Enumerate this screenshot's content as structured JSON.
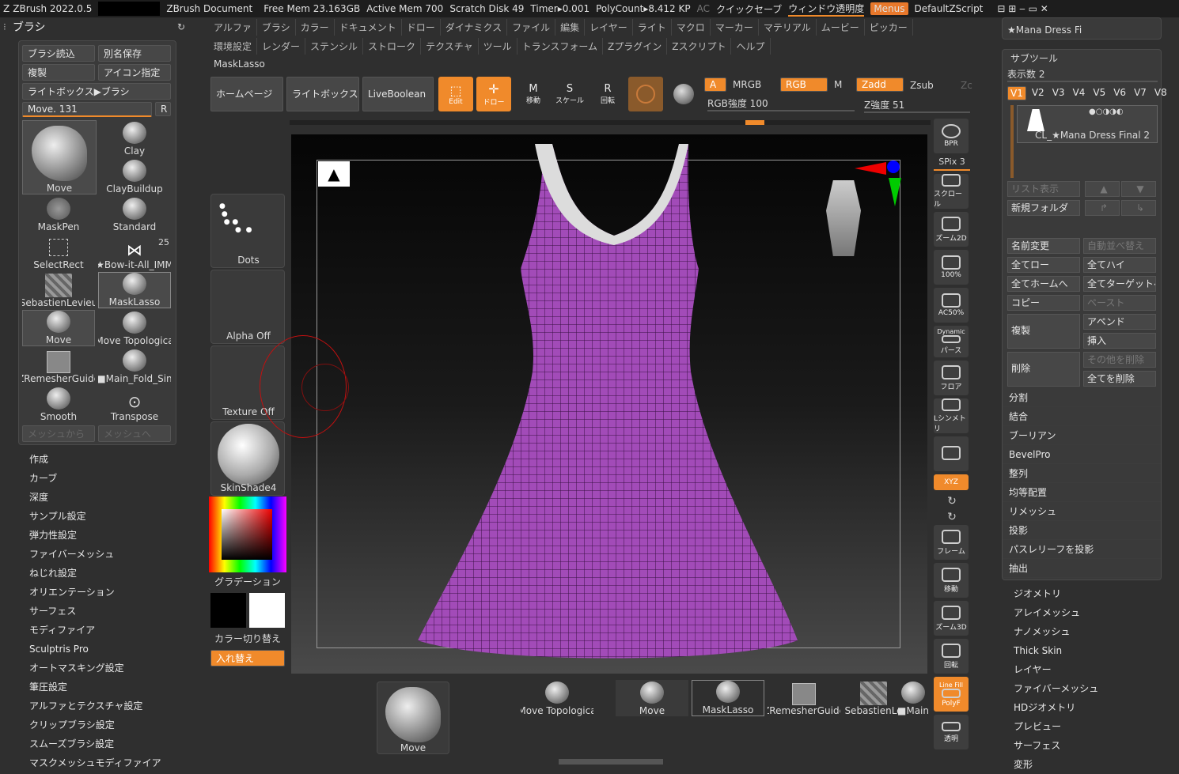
{
  "topbar": {
    "app": "ZBrush 2022.0.5",
    "doc": "ZBrush Document",
    "freemem": "Free Mem 23.163GB",
    "activemem": "Active Mem 700",
    "scratch": "Scratch Disk 49",
    "timer": "Timer▸0.001",
    "polycount": "PolyCount▸8.412 KP",
    "ac": "AC",
    "quicksave": "クイックセーブ",
    "transparency": "ウィンドウ透明度",
    "menus": "Menus",
    "zscript": "DefaultZScript"
  },
  "menu_row1": [
    "アルファ",
    "ブラシ",
    "カラー",
    "ドキュメント",
    "ドロー",
    "ダイナミクス",
    "ファイル",
    "編集",
    "レイヤー",
    "ライト",
    "マクロ",
    "マーカー",
    "マテリアル",
    "ムービー",
    "ピッカー"
  ],
  "menu_row2": [
    "環境設定",
    "レンダー",
    "ステンシル",
    "ストローク",
    "テクスチャ",
    "ツール",
    "トランスフォーム",
    "Zプラグイン",
    "Zスクリプト",
    "ヘルプ"
  ],
  "brush_panel": {
    "title": "ブラシ",
    "load": "ブラシ読込",
    "saveas": "別名保存",
    "clone": "複製",
    "iconset": "アイコン指定",
    "lightbox": "ライトボックス▶ブラシ",
    "move_label": "Move. 131",
    "r": "R",
    "from_mesh": "メッシュから",
    "to_mesh": "メッシュへ"
  },
  "brushes": [
    "Move",
    "Clay",
    "ClayBuildup",
    "MaskPen",
    "Standard",
    "SelectRect",
    "★Bow-it-All_IMM",
    "SebastienLevieu",
    "MaskLasso",
    "Move",
    "Move Topologica",
    "ZRemesherGuide",
    "■Main_Fold_Sin",
    "Smooth",
    "Transpose"
  ],
  "bow_count": "25",
  "left_menu": [
    "作成",
    "カーブ",
    "深度",
    "サンプル設定",
    "弾力性設定",
    "ファイバーメッシュ",
    "ねじれ設定",
    "オリエンテーション",
    "サーフェス",
    "モディファイア",
    "Sculptris Pro",
    "オートマスキング設定",
    "筆圧設定",
    "アルファとテクスチャ設定",
    "クリップブラシ設定",
    "スムーズブラシ設定",
    "マスクメッシュモディファイア"
  ],
  "toolbar": {
    "current": "MaskLasso",
    "home": "ホームページ",
    "lightbox": "ライトボックス",
    "liveboolean": "LiveBoolean",
    "edit": "Edit",
    "draw": "ドロー",
    "move": "移動",
    "scale": "スケール",
    "rotate": "回転",
    "a": "A",
    "mrgb": "MRGB",
    "rgb": "RGB",
    "m": "M",
    "zadd": "Zadd",
    "zsub": "Zsub",
    "zc": "Zc",
    "rgb_intensity": "RGB強度 100",
    "z_intensity": "Z強度 51"
  },
  "left_shelf": {
    "dots": "Dots",
    "alpha": "Alpha Off",
    "texture": "Texture Off",
    "material": "SkinShade4",
    "gradient": "グラデーション",
    "switch": "カラー切り替え",
    "swap": "入れ替え"
  },
  "right_tools": [
    "BPR",
    "SPix 3",
    "スクロール",
    "ズーム2D",
    "100%",
    "AC50%",
    "パース",
    "フロア",
    "Lシンメトリ",
    "",
    "XYZ",
    "",
    "",
    "フレーム",
    "移動",
    "ズーム3D",
    "回転",
    "PolyF",
    "透明"
  ],
  "right_dynamic": "Dynamic",
  "right_linefill": "Line Fill",
  "subtool": {
    "top": "★Mana Dress Fi",
    "title": "サブツール",
    "count": "表示数 2",
    "versions": [
      "V1",
      "V2",
      "V3",
      "V4",
      "V5",
      "V6",
      "V7",
      "V8"
    ],
    "item": "CL_★Mana Dress Final 2",
    "listview": "リスト表示",
    "newfolder": "新規フォルダ",
    "rename": "名前変更",
    "autoreorder": "自動並べ替え",
    "alllow": "全てロー",
    "allhigh": "全てハイ",
    "allhome": "全てホームへ",
    "alltarget": "全てターゲットへ",
    "copy": "コピー",
    "paste": "ペースト",
    "duplicate": "複製",
    "append": "アペンド",
    "insert": "挿入",
    "delete": "削除",
    "delother": "その他を削除",
    "delall": "全てを削除"
  },
  "subtool_menu": [
    "分割",
    "結合",
    "ブーリアン",
    "BevelPro",
    "整列",
    "均等配置",
    "リメッシュ",
    "投影",
    "パスレリーフを投影",
    "抽出"
  ],
  "right_menu": [
    "ジオメトリ",
    "アレイメッシュ",
    "ナノメッシュ",
    "Thick Skin",
    "レイヤー",
    "ファイバーメッシュ",
    "HDジオメトリ",
    "プレビュー",
    "サーフェス",
    "変形"
  ],
  "bottom_shelf": [
    "Move",
    "Move Topologica",
    "Move",
    "MaskLasso",
    "ZRemesherGuide",
    "SebastienLe",
    "■Main"
  ],
  "colors": {
    "accent": "#f08a2b",
    "dress": "#a24bb8",
    "bg": "#2f2f2f"
  }
}
